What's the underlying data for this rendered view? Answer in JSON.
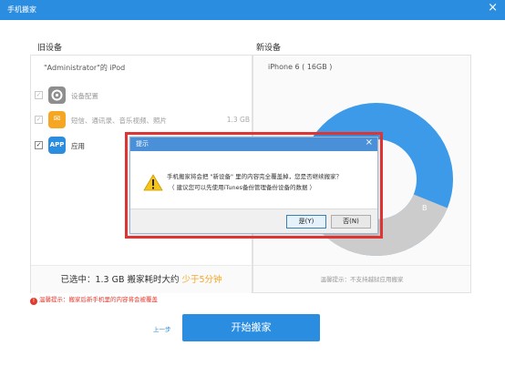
{
  "window": {
    "title": "手机搬家",
    "close_label": "×"
  },
  "old_section": {
    "label": "旧设备",
    "device_name": "\"Administrator\"的 iPod",
    "items": [
      {
        "label": "设备配置",
        "size": "",
        "checked": true,
        "disabled": true,
        "icon": "gear-icon",
        "icon_text": "",
        "icon_color": "#8e8e8e"
      },
      {
        "label": "短信、通讯录、音乐视频、照片",
        "size": "1.3 GB",
        "checked": true,
        "disabled": true,
        "icon": "envelope-icon",
        "icon_text": "✉",
        "icon_color": "#f5a623"
      },
      {
        "label": "应用",
        "size": "",
        "checked": true,
        "disabled": false,
        "icon": "app-icon",
        "icon_text": "APP",
        "icon_color": "#2b8de0"
      }
    ],
    "footer_text": "已选中：1.3 GB  搬家耗时大约 ",
    "footer_highlight": "少于5分钟"
  },
  "new_section": {
    "label": "新设备",
    "device_name": "iPhone 6 ( 16GB )",
    "footer_text": "温馨提示：不支持越狱应用搬家",
    "donut_used_fraction": 0.35,
    "donut_used_color": "#cccccc",
    "donut_free_color": "#3d9ae8",
    "donut_label": "B"
  },
  "warning": {
    "icon_text": "!",
    "text": "温馨提示：搬家后新手机里的内容将会被覆盖"
  },
  "actions": {
    "prev_label": "上一步",
    "start_label": "开始搬家"
  },
  "dialog": {
    "title": "提示",
    "close_label": "×",
    "line1": "手机搬家将会把 \"新设备\" 里的内容完全覆盖掉，您是否继续搬家？",
    "line2": "（ 建议您可以先使用iTunes备份管理备份设备的数据 ）",
    "yes_label": "是(Y)",
    "no_label": "否(N)"
  }
}
